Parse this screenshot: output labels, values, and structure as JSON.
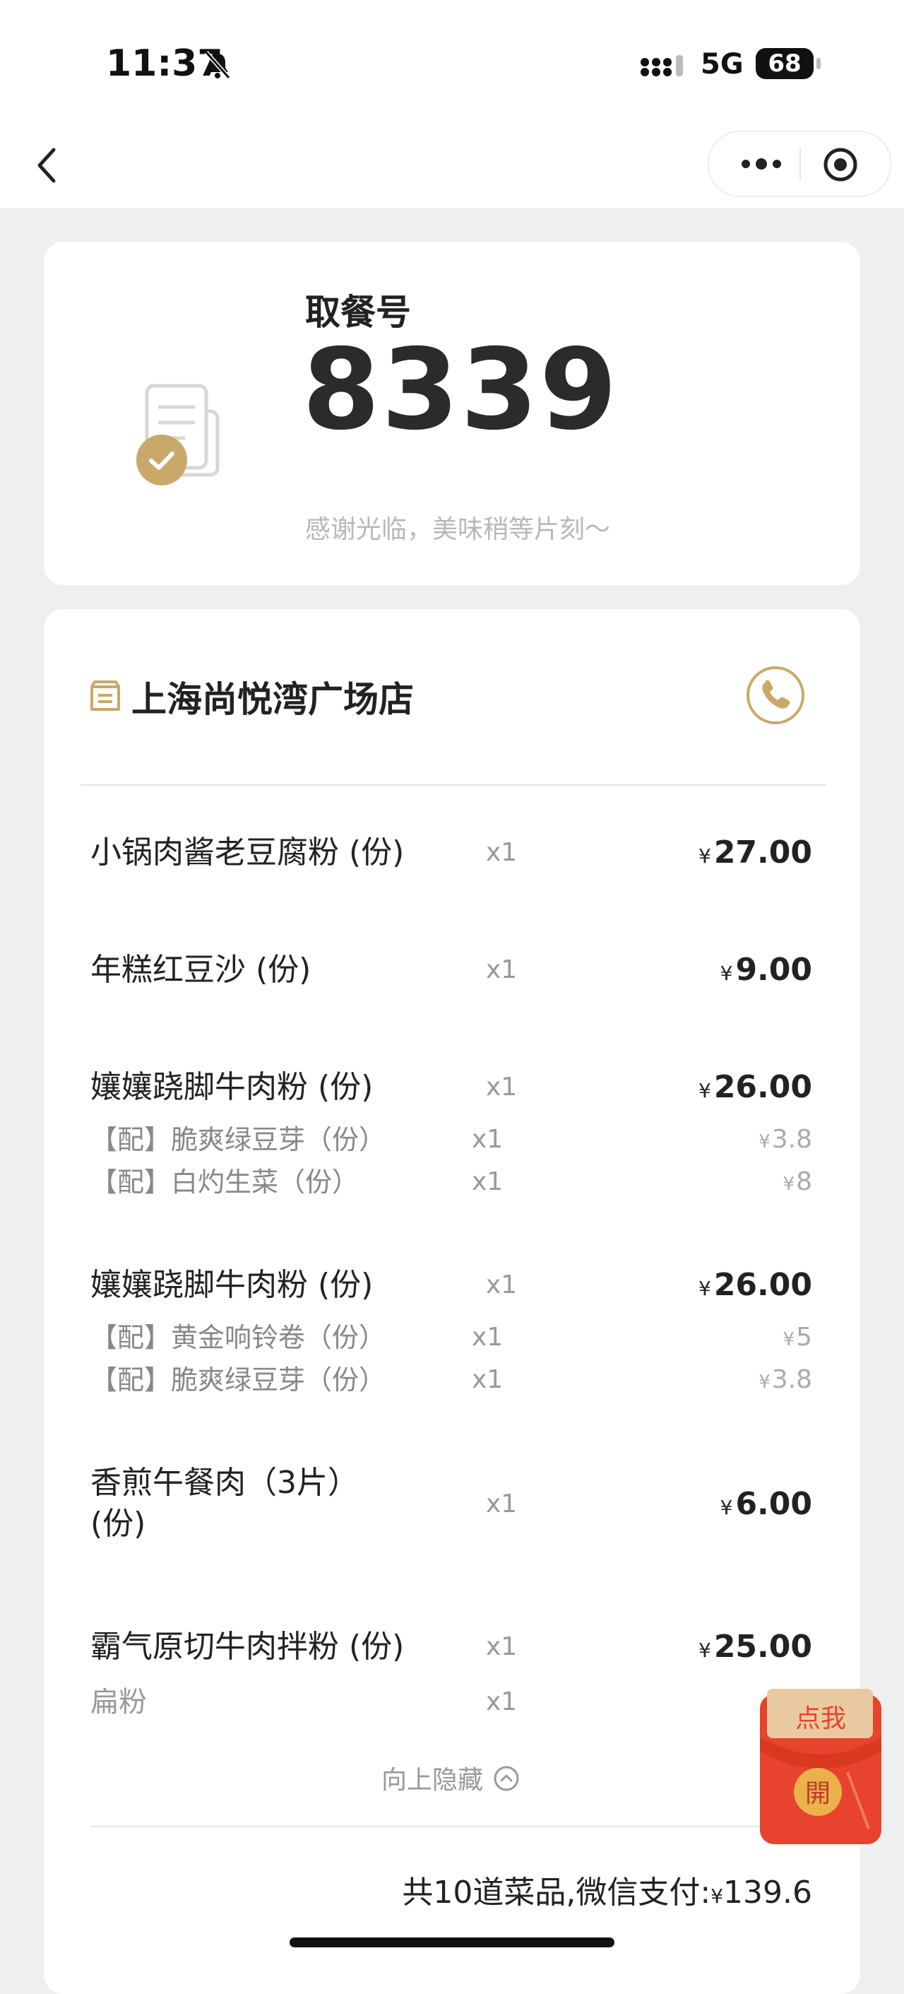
{
  "status_bar": {
    "time": "11:37",
    "network": "5G",
    "battery": "68"
  },
  "pickup": {
    "label": "取餐号",
    "number": "8339",
    "message": "感谢光临，美味稍等片刻～"
  },
  "store": {
    "name": "上海尚悦湾广场店"
  },
  "currency_symbol": "¥",
  "items": [
    {
      "name": "小锅肉酱老豆腐粉 (份)",
      "qty": "x1",
      "price": "27.00"
    },
    {
      "name": "年糕红豆沙 (份)",
      "qty": "x1",
      "price": "9.00"
    },
    {
      "name": "孃孃跷脚牛肉粉 (份)",
      "qty": "x1",
      "price": "26.00",
      "addons": [
        {
          "name": "【配】脆爽绿豆芽（份）",
          "qty": "x1",
          "price": "3.8"
        },
        {
          "name": "【配】白灼生菜（份）",
          "qty": "x1",
          "price": "8"
        }
      ]
    },
    {
      "name": "孃孃跷脚牛肉粉 (份)",
      "qty": "x1",
      "price": "26.00",
      "addons": [
        {
          "name": "【配】黄金响铃卷（份）",
          "qty": "x1",
          "price": "5"
        },
        {
          "name": "【配】脆爽绿豆芽（份）",
          "qty": "x1",
          "price": "3.8"
        }
      ]
    },
    {
      "name": "香煎午餐肉（3片）(份)",
      "qty": "x1",
      "price": "6.00"
    },
    {
      "name": "霸气原切牛肉拌粉 (份)",
      "qty": "x1",
      "price": "25.00",
      "options": [
        {
          "name": "扁粉",
          "qty": "x1"
        }
      ]
    }
  ],
  "collapse_label": "向上隐藏",
  "summary": {
    "text": "共10道菜品,微信支付:",
    "total": "139.6"
  },
  "red_packet": {
    "top": "点我",
    "seal": "開"
  },
  "colors": {
    "accent_gold": "#c9a86a",
    "red_packet": "#e8432e",
    "background": "#efefef"
  }
}
